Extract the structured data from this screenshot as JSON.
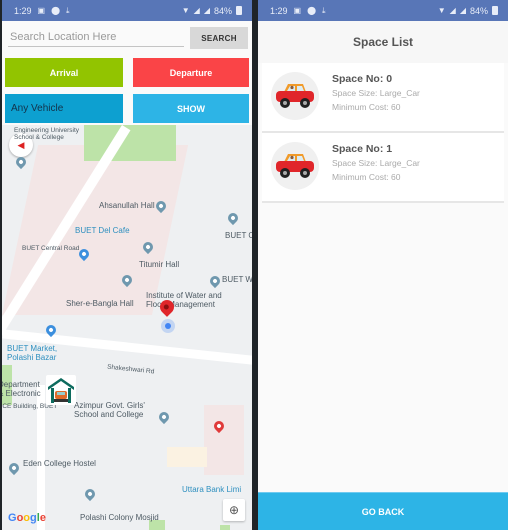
{
  "status_bar": {
    "time": "1:29",
    "battery": "84%",
    "left_icons": [
      "image-icon",
      "location-icon",
      "download-icon"
    ],
    "right_icons": [
      "wifi-icon",
      "signal-icon",
      "signal-icon",
      "battery-icon"
    ]
  },
  "map_screen": {
    "search": {
      "placeholder": "Search Location Here",
      "value": "",
      "button_label": "SEARCH"
    },
    "buttons": {
      "arrival": "Arrival",
      "departure": "Departure",
      "vehicle_selected": "Any Vehicle",
      "show": "SHOW"
    },
    "colors": {
      "arrival": "#92c400",
      "departure": "#fa4447",
      "vehicle": "#0da0d0",
      "show": "#2db4e6"
    },
    "map_labels": {
      "engineering_school": "Engineering University\nSchool & College",
      "ahsanullah_hall": "Ahsanullah Hall",
      "buet_del_cafe": "BUET Del Cafe",
      "buet_central_road": "BUET Central Road",
      "buet_c": "BUET Ce",
      "titumir_hall": "Titumir Hall",
      "buet_w": "BUET W",
      "institute": "Institute of Water and\nFlood Management",
      "sher_e_bangla": "Sher-e-Bangla Hall",
      "buet_market": "BUET Market,\nPolashi Bazar",
      "shakeshwari_rd": "Shakeshwari Rd",
      "department": "Department\n& Electronic",
      "ece_building": "ECE Building, BUET",
      "azimpur_school": "Azimpur Govt. Girls'\nSchool and College",
      "eden_hostel": "Eden College Hostel",
      "uttara_bank": "Uttara Bank Limi",
      "polashi_mosjid": "Polashi Colony Mosjid",
      "google": "Google"
    }
  },
  "space_screen": {
    "title": "Space List",
    "spaces": [
      {
        "number_label": "Space No: 0",
        "size_label": "Space Size: Large_Car",
        "cost_label": "Minimum Cost: 60"
      },
      {
        "number_label": "Space No: 1",
        "size_label": "Space Size: Large_Car",
        "cost_label": "Minimum Cost: 60"
      }
    ],
    "go_back_label": "GO BACK",
    "accent": "#2db4e6"
  }
}
